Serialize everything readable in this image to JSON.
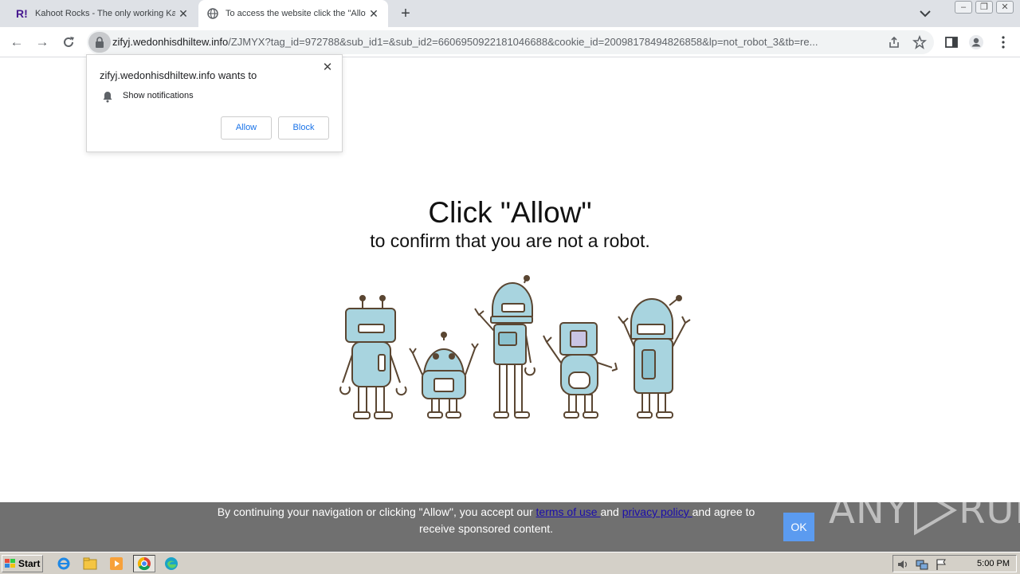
{
  "browser": {
    "tabs": [
      {
        "title": "Kahoot Rocks - The only working Kahoot",
        "active": false
      },
      {
        "title": "To access the website click the \"Allow\"",
        "active": true
      }
    ],
    "url_host": "zifyj.wedonhisdhiltew.info",
    "url_path": "/ZJMYX?tag_id=972788&sub_id1=&sub_id2=6606950922181046688&cookie_id=200981784948268​58&lp=not_robot_3&tb=re..."
  },
  "prompt": {
    "title": "zifyj.wedonhisdhiltew.info wants to",
    "permission": "Show notifications",
    "allow_label": "Allow",
    "block_label": "Block"
  },
  "page": {
    "headline": "Click \"Allow\"",
    "subline": "to confirm that you are not a robot."
  },
  "consent": {
    "text_before": "By continuing your navigation or clicking \"Allow\", you accept our ",
    "terms_link": "terms of use ",
    "text_mid": "and ",
    "privacy_link": "privacy policy ",
    "text_after": "and agree to receive sponsored content.",
    "ok_label": "OK"
  },
  "watermark": {
    "left": "ANY",
    "right": "RUN"
  },
  "taskbar": {
    "start_label": "Start",
    "clock": "5:00 PM"
  },
  "colors": {
    "robot_fill": "#a8d4df",
    "robot_stroke": "#5a4632",
    "consent_bg": "#707070",
    "ok_button": "#5b9bf0"
  }
}
